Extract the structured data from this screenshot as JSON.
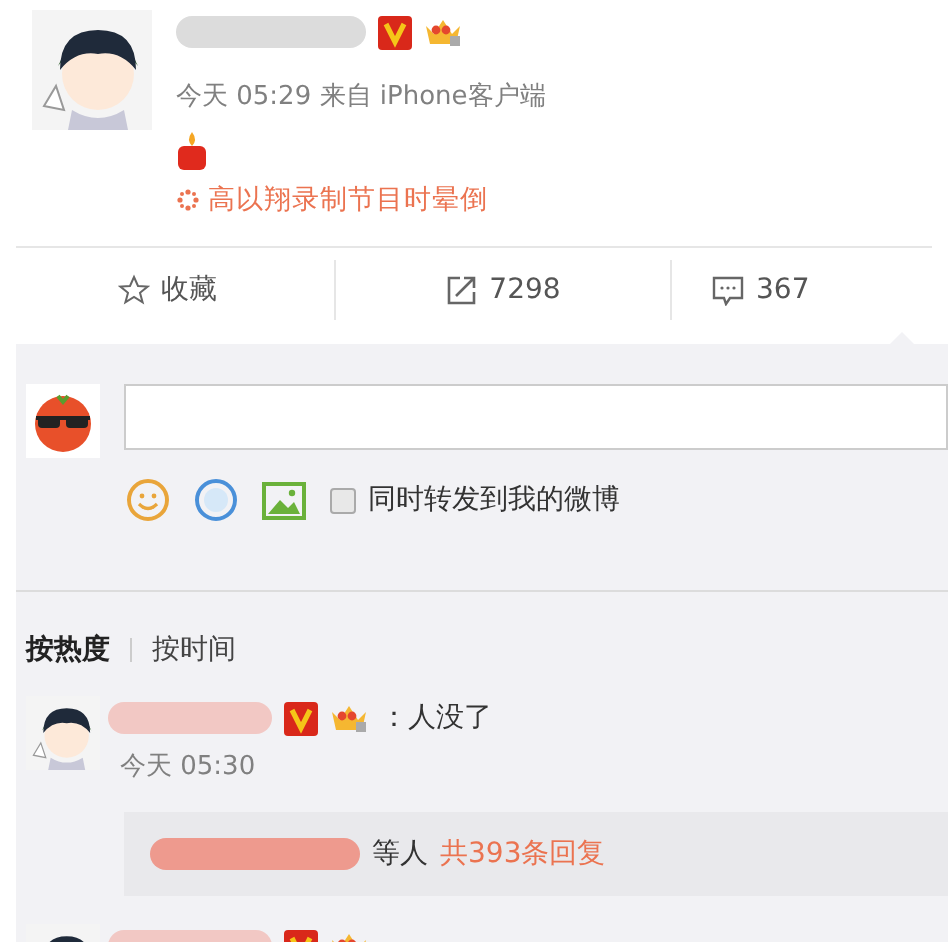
{
  "post": {
    "time": "今天 05:29",
    "source_prefix": "来自",
    "source": "iPhone客户端",
    "topic": "高以翔录制节目时晕倒"
  },
  "actions": [
    {
      "kind": "favorite",
      "label": "收藏"
    },
    {
      "kind": "repost",
      "label": "7298"
    },
    {
      "kind": "comment",
      "label": "367"
    }
  ],
  "composer": {
    "share_label": "同时转发到我的微博",
    "share_checked": false
  },
  "sort_tabs": [
    {
      "label": "按热度",
      "selected": true
    },
    {
      "label": "按时间",
      "selected": false
    }
  ],
  "comments": [
    {
      "text": "：人没了",
      "time": "今天 05:30",
      "reply_suffix": "等人",
      "reply_count": "共393条回复"
    }
  ]
}
